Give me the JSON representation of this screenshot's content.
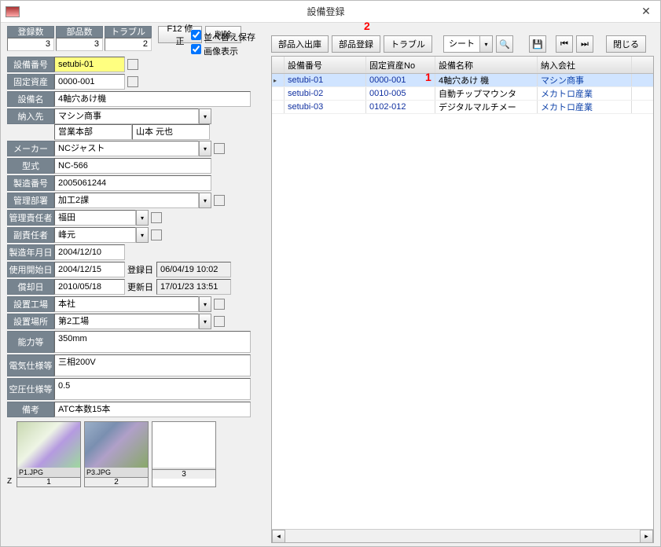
{
  "window": {
    "title": "設備登録"
  },
  "markers": {
    "m1": "1",
    "m2": "2"
  },
  "stats": {
    "count_label": "登録数",
    "count_val": "3",
    "parts_label": "部品数",
    "parts_val": "3",
    "trouble_label": "トラブル",
    "trouble_val": "2"
  },
  "left_toolbar": {
    "edit": "F12 修正",
    "delete": "削除"
  },
  "options": {
    "sort_save": "並べ替え保存",
    "image_show": "画像表示"
  },
  "right_toolbar": {
    "parts_io": "部品入出庫",
    "parts_reg": "部品登録",
    "trouble": "トラブル",
    "sheet": "シート",
    "close": "閉じる"
  },
  "icons": {
    "print": "🖨",
    "save": "💾",
    "first": "⏮",
    "last": "⏭"
  },
  "form": {
    "equip_no_label": "設備番号",
    "equip_no": "setubi-01",
    "asset_no_label": "固定資産No",
    "asset_no": "0000-001",
    "equip_name_label": "設備名",
    "equip_name": "4軸穴あけ機",
    "dest_label": "納入先",
    "dest": "マシン商事",
    "dept": "営業本部",
    "person": "山本 元也",
    "maker_label": "メーカー",
    "maker": "NCジャスト",
    "model_label": "型式",
    "model": "NC-566",
    "mfg_no_label": "製造番号",
    "mfg_no": "2005061244",
    "mgmt_dept_label": "管理部署",
    "mgmt_dept": "加工2課",
    "mgr_label": "管理責任者",
    "mgr": "福田",
    "sub_mgr_label": "副責任者",
    "sub_mgr": "峰元",
    "mfg_date_label": "製造年月日",
    "mfg_date": "2004/12/10",
    "use_start_label": "使用開始日",
    "use_start": "2004/12/15",
    "reg_date_label": "登録日",
    "reg_date": "06/04/19 10:02",
    "dep_date_label": "償却日",
    "dep_date": "2010/05/18",
    "upd_date_label": "更新日",
    "upd_date": "17/01/23 13:51",
    "plant_label": "設置工場",
    "plant": "本社",
    "loc_label": "設置場所",
    "loc": "第2工場",
    "capacity_label": "能力等",
    "capacity": "350mm",
    "elec_label": "電気仕様等",
    "elec": "三相200V",
    "air_label": "空圧仕様等",
    "air": "0.5",
    "remarks_label": "備考",
    "remarks": "ATC本数15本"
  },
  "thumbs": {
    "z": "Z",
    "items": [
      {
        "name": "P1.JPG",
        "num": "1"
      },
      {
        "name": "P3.JPG",
        "num": "2"
      },
      {
        "name": "",
        "num": "3"
      }
    ]
  },
  "grid": {
    "headers": {
      "c1": "設備番号",
      "c2": "固定資産No",
      "c3": "設備名称",
      "c4": "納入会社"
    },
    "rows": [
      {
        "c1": "setubi-01",
        "c2": "0000-001",
        "c3": "4軸穴あけ 機",
        "c4": "マシン商事"
      },
      {
        "c1": "setubi-02",
        "c2": "0010-005",
        "c3": "自動チップマウンタ",
        "c4": "メカトロ産業"
      },
      {
        "c1": "setubi-03",
        "c2": "0102-012",
        "c3": "デジタルマルチメー",
        "c4": "メカトロ産業"
      }
    ]
  }
}
